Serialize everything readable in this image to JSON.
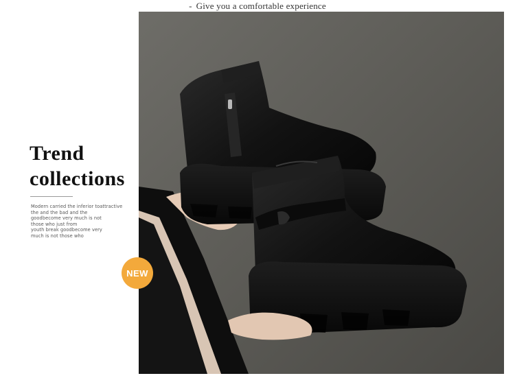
{
  "header": {
    "dash": "-",
    "tagline": "Give you a comfortable experience"
  },
  "title": {
    "line1": "Trend",
    "line2": "collections"
  },
  "description": {
    "lines": [
      "Modern carried the inferior toattractive",
      "the and the bad and the",
      "goodbecome very much is not",
      "those who just from",
      "youth break goodbecome very",
      "much is not those who"
    ]
  },
  "badge": {
    "label": "NEW",
    "color": "#f3a93b"
  },
  "photo": {
    "subject": "boots-photo",
    "background_color": "#5e5d58",
    "boot_color": "#111111"
  }
}
